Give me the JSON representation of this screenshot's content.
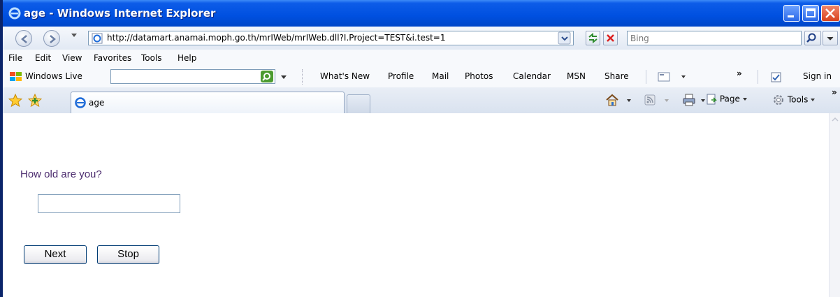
{
  "window": {
    "title": "age - Windows Internet Explorer"
  },
  "address": {
    "url": "http://datamart.anamai.moph.go.th/mrIWeb/mrIWeb.dll?I.Project=TEST&i.test=1"
  },
  "search": {
    "placeholder": "Bing"
  },
  "menubar": {
    "items": [
      "File",
      "Edit",
      "View",
      "Favorites",
      "Tools",
      "Help"
    ]
  },
  "windows_live": {
    "label": "Windows Live",
    "links": [
      "What's New",
      "Profile",
      "Mail",
      "Photos",
      "Calendar",
      "MSN",
      "Share"
    ],
    "sign_in": "Sign in"
  },
  "tabs": {
    "active_label": "age"
  },
  "commands": {
    "page": "Page",
    "tools": "Tools"
  },
  "page": {
    "question": "How old are you?",
    "answer_value": "",
    "next_label": "Next",
    "stop_label": "Stop"
  },
  "colors": {
    "titlebar": "#0050e0",
    "question_text": "#4b2b6e"
  }
}
